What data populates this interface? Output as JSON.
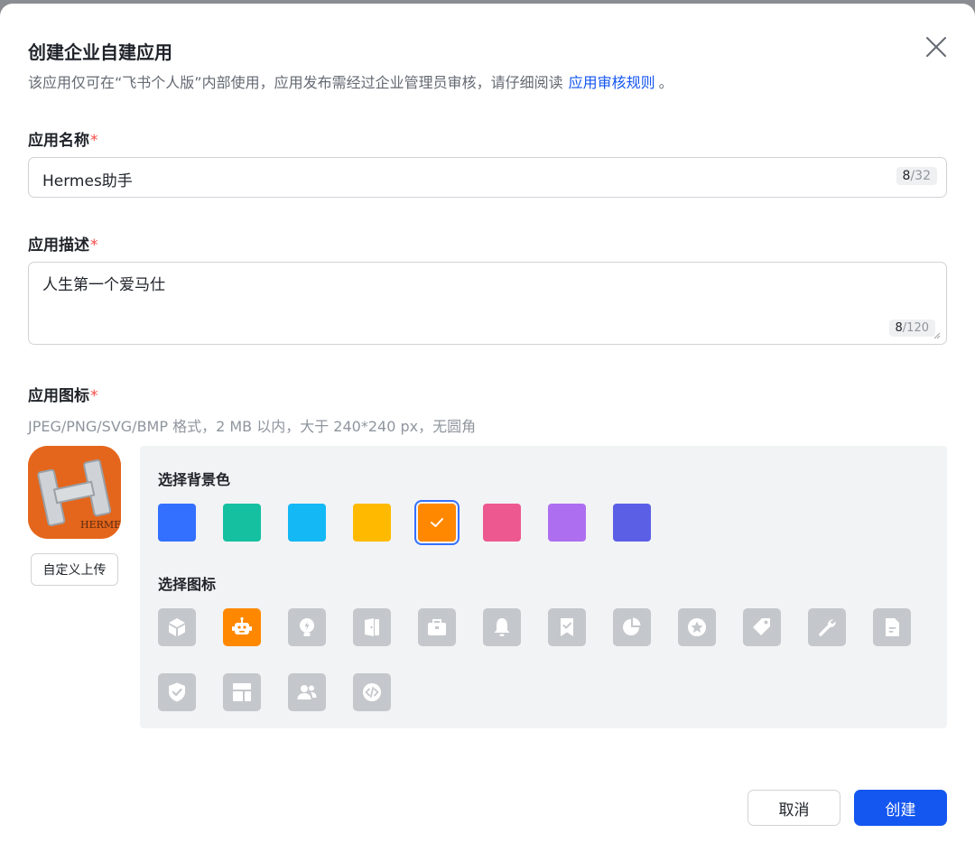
{
  "dialog": {
    "title": "创建企业自建应用",
    "subtitle": "该应用仅可在“飞书个人版”内部使用，应用发布需经过企业管理员审核，请仔细阅读",
    "rules_link": "应用审核规则",
    "subtitle_tail": "。"
  },
  "name_field": {
    "label": "应用名称",
    "required": "*",
    "value": "Hermes助手",
    "count": "8",
    "max": "/32"
  },
  "desc_field": {
    "label": "应用描述",
    "required": "*",
    "value": "人生第一个爱马仕",
    "count": "8",
    "max": "/120"
  },
  "icon_field": {
    "label": "应用图标",
    "required": "*",
    "hint": "JPEG/PNG/SVG/BMP 格式，2 MB 以内，大于 240*240 px，无圆角",
    "upload_label": "自定义上传",
    "preview_text": "HERMES"
  },
  "bg_picker": {
    "label": "选择背景色",
    "colors": [
      "#3370ff",
      "#14c0a0",
      "#14b8f5",
      "#ffba00",
      "#ff8800",
      "#ed5890",
      "#ad6ff0",
      "#5b5fe6"
    ],
    "selected_index": 4
  },
  "icon_picker": {
    "label": "选择图标",
    "icons": [
      "cube-icon",
      "robot-icon",
      "lightbulb-icon",
      "door-icon",
      "briefcase-icon",
      "bell-icon",
      "bookmark-check-icon",
      "pie-chart-icon",
      "star-badge-icon",
      "tag-icon",
      "wrench-icon",
      "document-icon",
      "shield-check-icon",
      "layout-icon",
      "users-icon",
      "code-icon"
    ],
    "selected_index": 1
  },
  "footer": {
    "cancel_label": "取消",
    "create_label": "创建"
  }
}
